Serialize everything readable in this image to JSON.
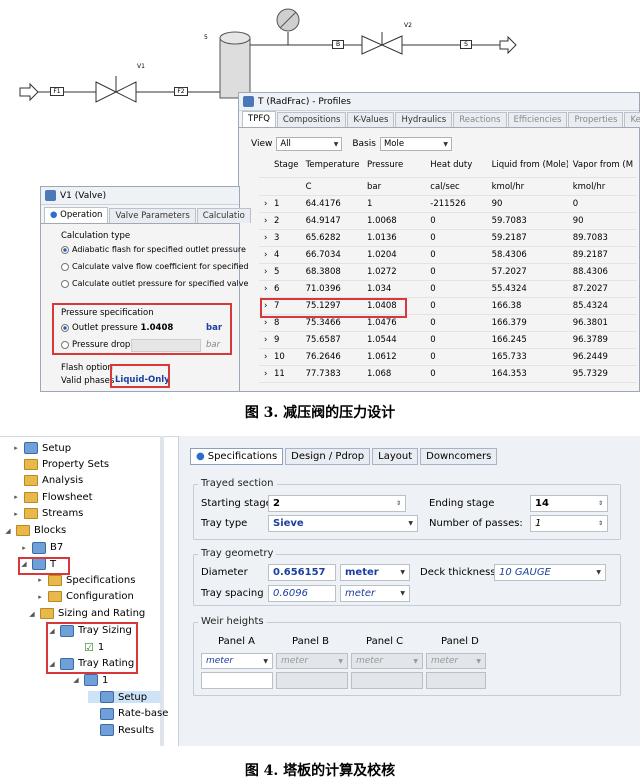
{
  "flowsheet": {
    "streams": [
      "F1",
      "F2",
      "B",
      "S"
    ],
    "valves": [
      "V1",
      "V2"
    ],
    "column_label": "5"
  },
  "profiles_window": {
    "title": "T (RadFrac) - Profiles",
    "tabs": [
      "TPFQ",
      "Compositions",
      "K-Values",
      "Hydraulics",
      "Reactions",
      "Efficiencies",
      "Properties",
      "Key"
    ],
    "view_label": "View",
    "view_value": "All",
    "basis_label": "Basis",
    "basis_value": "Mole",
    "columns": [
      "Stage",
      "Temperature",
      "Pressure",
      "Heat duty",
      "Liquid from (Mole)",
      "Vapor from (M"
    ],
    "units": [
      "",
      "C",
      "bar",
      "cal/sec",
      "kmol/hr",
      "kmol/hr"
    ],
    "rows": [
      [
        "1",
        "64.4176",
        "1",
        "-211526",
        "90",
        "0"
      ],
      [
        "2",
        "64.9147",
        "1.0068",
        "0",
        "59.7083",
        "90"
      ],
      [
        "3",
        "65.6282",
        "1.0136",
        "0",
        "59.2187",
        "89.7083"
      ],
      [
        "4",
        "66.7034",
        "1.0204",
        "0",
        "58.4306",
        "89.2187"
      ],
      [
        "5",
        "68.3808",
        "1.0272",
        "0",
        "57.2027",
        "88.4306"
      ],
      [
        "6",
        "71.0396",
        "1.034",
        "0",
        "55.4324",
        "87.2027"
      ],
      [
        "7",
        "75.1297",
        "1.0408",
        "0",
        "166.38",
        "85.4324"
      ],
      [
        "8",
        "75.3466",
        "1.0476",
        "0",
        "166.379",
        "96.3801"
      ],
      [
        "9",
        "75.6587",
        "1.0544",
        "0",
        "166.245",
        "96.3789"
      ],
      [
        "10",
        "76.2646",
        "1.0612",
        "0",
        "165.733",
        "96.2449"
      ],
      [
        "11",
        "77.7383",
        "1.068",
        "0",
        "164.353",
        "95.7329"
      ]
    ]
  },
  "valve_window": {
    "title": "V1 (Valve)",
    "tabs": [
      "Operation",
      "Valve Parameters",
      "Calculatio"
    ],
    "calc_type_legend": "Calculation type",
    "calc_options": [
      "Adiabatic flash for specified outlet pressure",
      "Calculate valve flow coefficient for specified",
      "Calculate outlet pressure for specified valve"
    ],
    "pressure_spec_legend": "Pressure specification",
    "outlet_pressure_label": "Outlet pressure",
    "outlet_pressure_value": "1.0408",
    "outlet_pressure_unit": "bar",
    "pressure_drop_label": "Pressure drop",
    "pressure_drop_unit": "bar",
    "flash_options_label": "Flash option",
    "valid_phases_label": "Valid phases",
    "valid_phases_value": "Liquid-Only"
  },
  "caption3": "图 3. 减压阀的压力设计",
  "tree": {
    "items": [
      "Setup",
      "Property Sets",
      "Analysis",
      "Flowsheet",
      "Streams",
      "Blocks",
      "B7",
      "T",
      "Specifications",
      "Configuration",
      "Sizing and Rating",
      "Tray Sizing",
      "1",
      "Tray Rating",
      "1",
      "Setup",
      "Rate-base",
      "Results"
    ]
  },
  "tray_panel": {
    "tabs": [
      "Specifications",
      "Design / Pdrop",
      "Layout",
      "Downcomers"
    ],
    "trayed_section_legend": "Trayed section",
    "starting_stage_label": "Starting stage",
    "starting_stage_value": "2",
    "ending_stage_label": "Ending stage",
    "ending_stage_value": "14",
    "tray_type_label": "Tray type",
    "tray_type_value": "Sieve",
    "passes_label": "Number of passes:",
    "passes_value": "1",
    "tray_geometry_legend": "Tray geometry",
    "diameter_label": "Diameter",
    "diameter_value": "0.656157",
    "diameter_unit": "meter",
    "deck_label": "Deck thickness",
    "deck_value": "10 GAUGE",
    "spacing_label": "Tray spacing",
    "spacing_value": "0.6096",
    "spacing_unit": "meter",
    "weir_legend": "Weir heights",
    "panels": [
      "Panel A",
      "Panel B",
      "Panel C",
      "Panel D"
    ],
    "panel_unit": "meter"
  },
  "caption4": "图 4. 塔板的计算及校核"
}
